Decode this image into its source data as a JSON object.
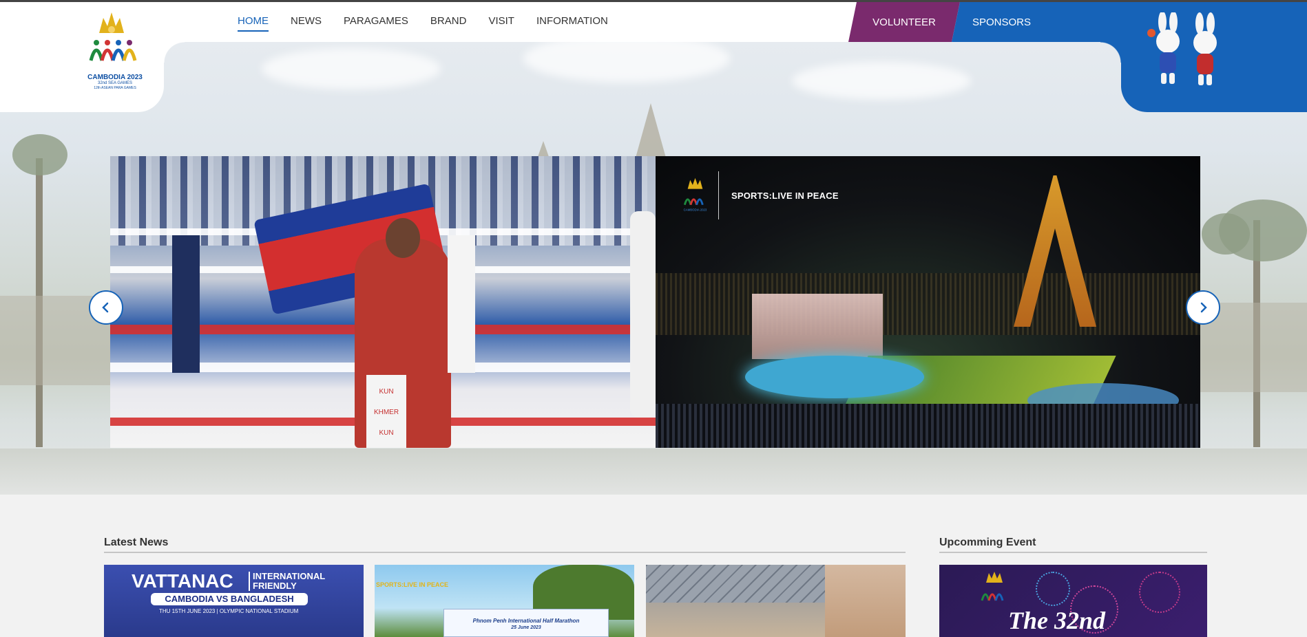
{
  "header": {
    "logo": {
      "title": "CAMBODIA 2023",
      "subtitle": "32nd SEA GAMES",
      "tagline": "12th ASEAN PARA GAMES"
    },
    "nav": [
      {
        "label": "HOME",
        "active": true
      },
      {
        "label": "NEWS",
        "active": false
      },
      {
        "label": "PARAGAMES",
        "active": false
      },
      {
        "label": "BRAND",
        "active": false
      },
      {
        "label": "VISIT",
        "active": false
      },
      {
        "label": "INFORMATION",
        "active": false
      }
    ],
    "volunteer_label": "VOLUNTEER",
    "sponsors_label": "SPONSORS"
  },
  "carousel": {
    "slide1": {
      "sign_text": "KUN KHMER",
      "rope_text": "KUN KHMER"
    },
    "slide2": {
      "brand_text": "SPORTS:LIVE IN PEACE",
      "brand_logo_text": "CAMBODIA 2023"
    }
  },
  "latest_news": {
    "title": "Latest News",
    "cards": [
      {
        "headline": "VATTANAC",
        "tag": "INTERNATIONAL FRIENDLY",
        "match": "CAMBODIA VS BANGLADESH",
        "date": "THU 15TH JUNE 2023 | OLYMPIC NATIONAL STADIUM"
      },
      {
        "tag": "SPORTS:LIVE IN PEACE",
        "banner": "Phnom Penh International Half Marathon",
        "banner_date": "25 June 2023"
      },
      {
        "alt": "Indoor sports hall"
      }
    ]
  },
  "upcoming_event": {
    "title": "Upcomming Event",
    "card_title": "The 32nd"
  },
  "colors": {
    "brand_blue": "#1663b8",
    "volunteer_purple": "#7a2a6d",
    "background": "#f2f2f2"
  }
}
